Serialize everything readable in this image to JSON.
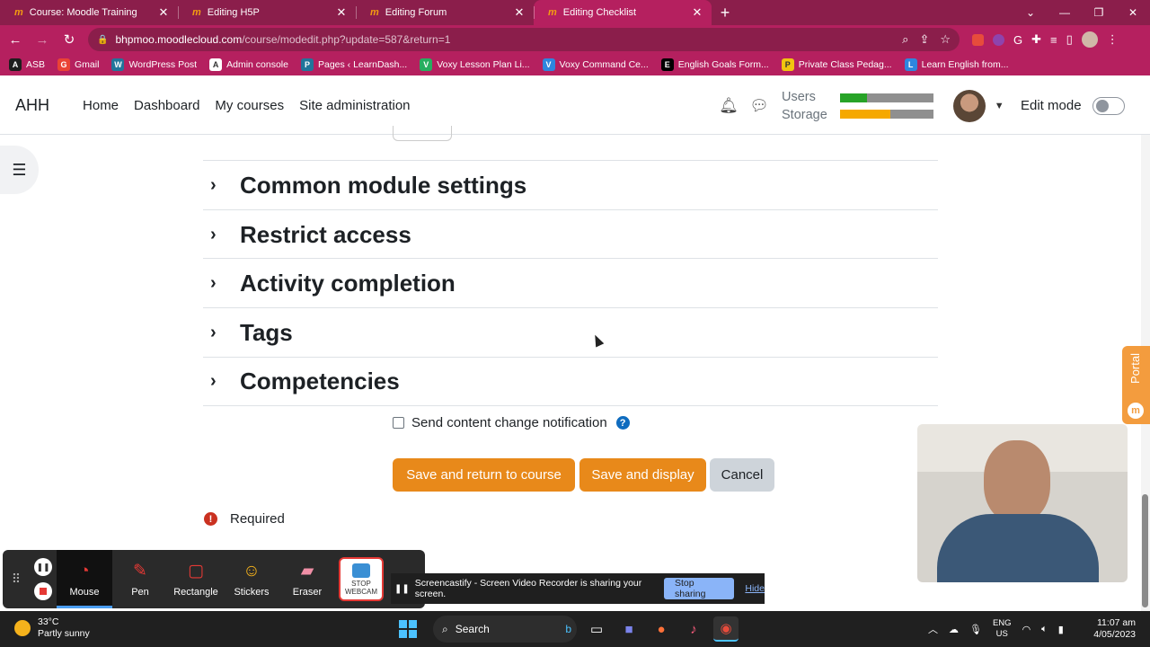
{
  "browser": {
    "tabs": [
      {
        "title": "Course: Moodle Training",
        "active": false
      },
      {
        "title": "Editing H5P",
        "active": false
      },
      {
        "title": "Editing Forum",
        "active": false
      },
      {
        "title": "Editing Checklist",
        "active": true
      }
    ],
    "url_host": "bhpmoo.moodlecloud.com",
    "url_path": "/course/modedit.php?update=587&return=1",
    "bookmarks": [
      {
        "label": "ASB",
        "icon": "asb-icon",
        "color": "#1d1d1d"
      },
      {
        "label": "Gmail",
        "icon": "gmail-icon",
        "color": "#ea4335"
      },
      {
        "label": "WordPress Post",
        "icon": "wordpress-icon",
        "color": "#21759b"
      },
      {
        "label": "Admin console",
        "icon": "google-icon",
        "color": "#ffffff"
      },
      {
        "label": "Pages ‹ LearnDash...",
        "icon": "wordpress-icon",
        "color": "#21759b"
      },
      {
        "label": "Voxy Lesson Plan Li...",
        "icon": "voxy-plus-icon",
        "color": "#27ae60"
      },
      {
        "label": "Voxy Command Ce...",
        "icon": "voxy-icon",
        "color": "#2e86de"
      },
      {
        "label": "English Goals Form...",
        "icon": "circle-icon",
        "color": "#000000"
      },
      {
        "label": "Private Class Pedag...",
        "icon": "doc-icon",
        "color": "#f1c40f"
      },
      {
        "label": "Learn English from...",
        "icon": "voxy-icon",
        "color": "#2e86de"
      }
    ]
  },
  "navbar": {
    "brand": "AHH",
    "links": [
      "Home",
      "Dashboard",
      "My courses",
      "Site administration"
    ],
    "quota_users_label": "Users",
    "quota_storage_label": "Storage",
    "quota_users_fraction": 0.29,
    "quota_storage_fraction": 0.54,
    "quota_users_color": "#27a327",
    "quota_storage_color": "#f5a800",
    "edit_mode_label": "Edit mode",
    "edit_mode_on": false
  },
  "form": {
    "sections": [
      {
        "title": "Common module settings"
      },
      {
        "title": "Restrict access"
      },
      {
        "title": "Activity completion"
      },
      {
        "title": "Tags"
      },
      {
        "title": "Competencies"
      }
    ],
    "notify_label": "Send content change notification",
    "notify_checked": false,
    "buttons": {
      "save_return": "Save and return to course",
      "save_display": "Save and display",
      "cancel": "Cancel"
    },
    "required_label": "Required"
  },
  "portal_label": "Portal",
  "screencastify": {
    "tools": [
      {
        "label": "Mouse",
        "icon": "mouse-icon",
        "active": true
      },
      {
        "label": "Pen",
        "icon": "pen-icon",
        "active": false
      },
      {
        "label": "Rectangle",
        "icon": "rectangle-icon",
        "active": false
      },
      {
        "label": "Stickers",
        "icon": "sticker-icon",
        "active": false
      },
      {
        "label": "Eraser",
        "icon": "eraser-icon",
        "active": false
      }
    ],
    "stop_webcam_line1": "STOP",
    "stop_webcam_line2": "WEBCAM",
    "share_message": "Screencastify - Screen Video Recorder is sharing your screen.",
    "stop_sharing": "Stop sharing",
    "hide": "Hide"
  },
  "taskbar": {
    "temp": "33°C",
    "weather": "Partly sunny",
    "search": "Search",
    "lang1": "ENG",
    "lang2": "US",
    "time": "11:07 am",
    "date": "4/05/2023"
  },
  "colors": {
    "browser_dark": "#8b1e4b",
    "browser_light": "#b5205f",
    "primary_button": "#e8891a"
  }
}
